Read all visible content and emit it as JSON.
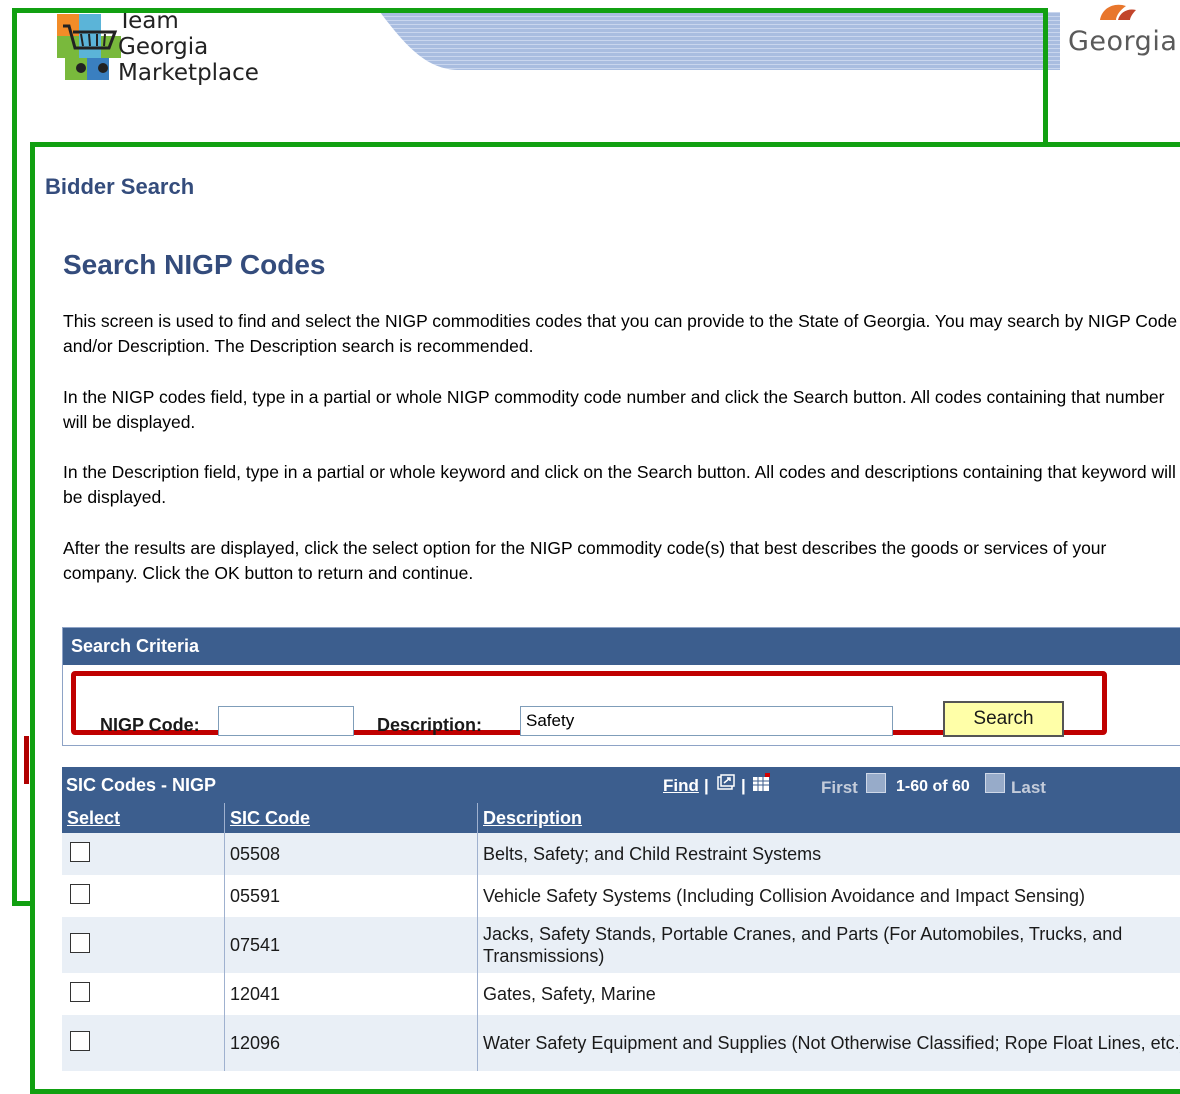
{
  "header": {
    "logo_line1": "Team",
    "logo_line2": "Georgia",
    "logo_line3": "Marketplace",
    "brand": "Georgia"
  },
  "page": {
    "section_title": "Bidder Search",
    "title": "Search NIGP Codes",
    "paragraphs": [
      "This screen is used to find and select the NIGP commodities codes that you can provide to the State of Georgia. You may search by NIGP Code and/or Description. The Description search is recommended.",
      "In the NIGP codes field, type in a partial or whole NIGP commodity code number and click the Search button. All codes containing that number will be displayed.",
      "In the Description field, type in a partial or whole keyword and click on the Search button. All codes and descriptions containing that keyword will be displayed.",
      "After the results are displayed, click the select option for the NIGP commodity code(s) that best describes the goods or services of your company. Click the OK button to return and continue."
    ]
  },
  "search": {
    "header": "Search Criteria",
    "nigp_label": "NIGP Code:",
    "nigp_value": "",
    "description_label": "Description:",
    "description_value": "Safety",
    "button": "Search"
  },
  "grid": {
    "title": "SIC Codes - NIGP",
    "find": "Find",
    "first": "First",
    "range": "1-60 of 60",
    "last": "Last",
    "columns": [
      "Select",
      "SIC Code",
      "Description"
    ],
    "rows": [
      {
        "code": "05508",
        "description": "Belts, Safety; and Child Restraint Systems"
      },
      {
        "code": "05591",
        "description": "Vehicle Safety Systems (Including Collision Avoidance and Impact Sensing)"
      },
      {
        "code": "07541",
        "description": "Jacks, Safety Stands, Portable Cranes, and Parts (For Automobiles, Trucks, and Transmissions)"
      },
      {
        "code": "12041",
        "description": "Gates, Safety, Marine"
      },
      {
        "code": "12096",
        "description": "Water Safety Equipment and Supplies (Not Otherwise Classified; Rope Float Lines, etc.)"
      }
    ]
  },
  "colors": {
    "frame_green": "#11a011",
    "highlight_red": "#c00000",
    "header_blue": "#3c5e8e",
    "title_blue": "#344c7c",
    "button_yellow": "#ffffa8"
  }
}
